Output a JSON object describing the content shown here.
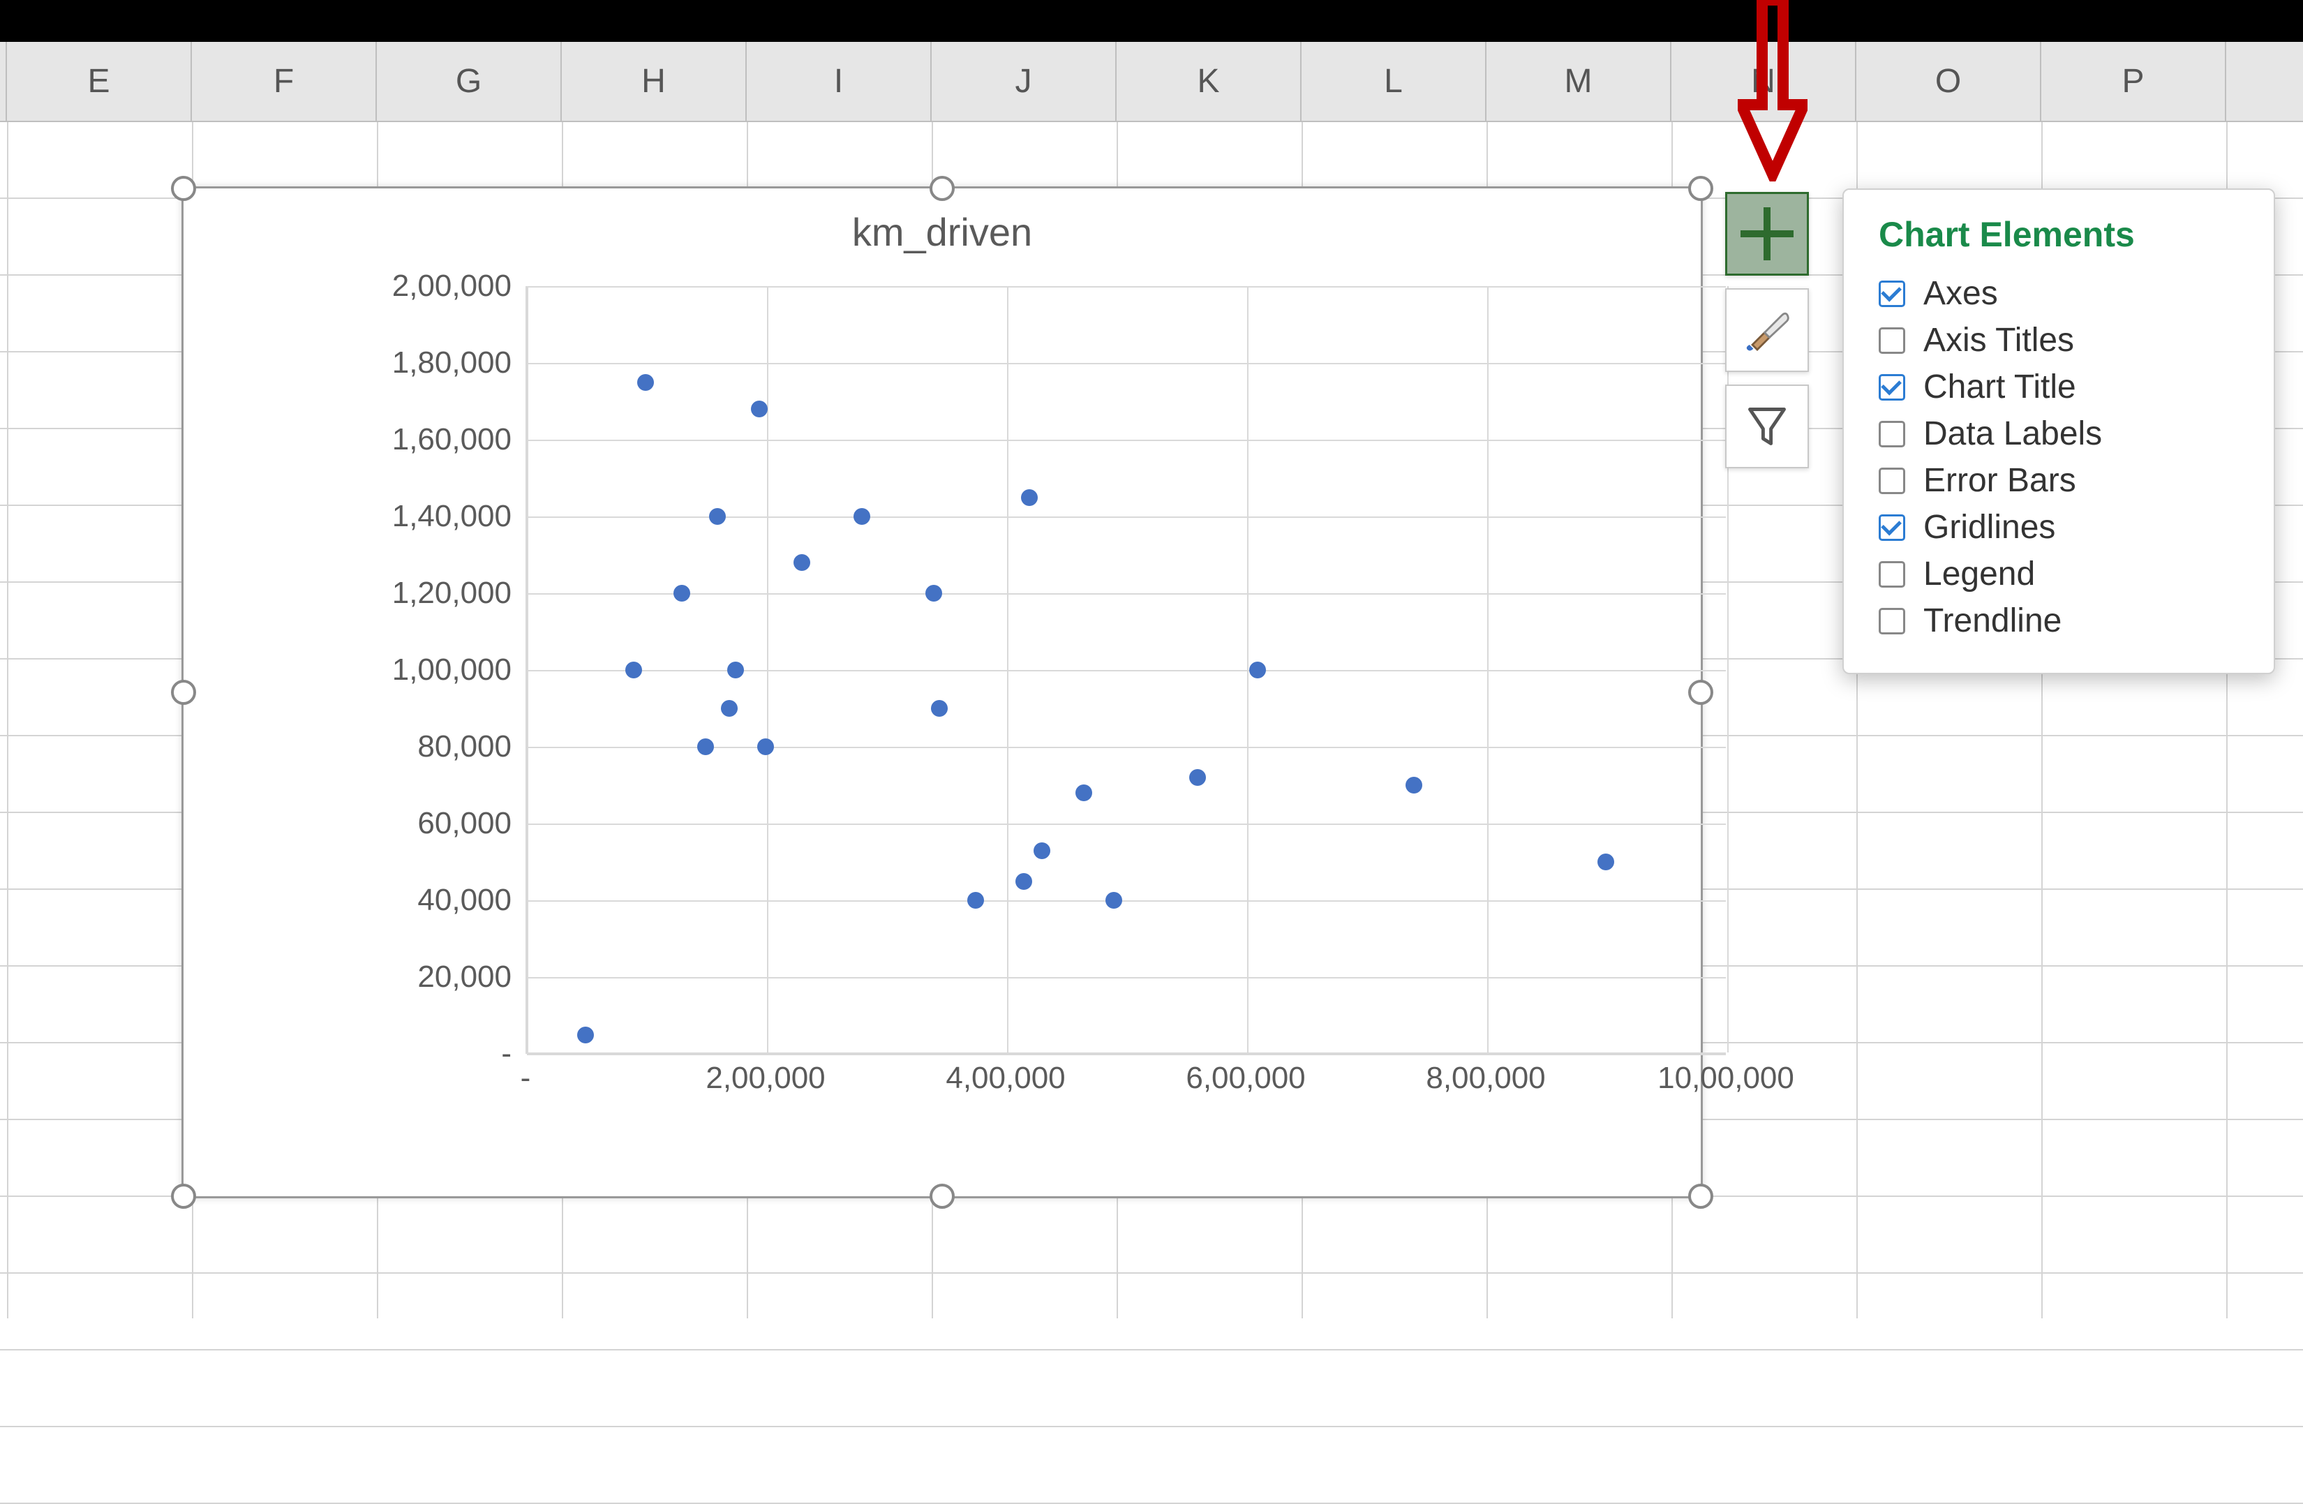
{
  "columns": [
    "E",
    "F",
    "G",
    "H",
    "I",
    "J",
    "K",
    "L",
    "M",
    "N",
    "O",
    "P"
  ],
  "chart_elements_panel": {
    "title": "Chart Elements",
    "items": [
      {
        "label": "Axes",
        "checked": true
      },
      {
        "label": "Axis Titles",
        "checked": false
      },
      {
        "label": "Chart Title",
        "checked": true
      },
      {
        "label": "Data Labels",
        "checked": false
      },
      {
        "label": "Error Bars",
        "checked": false
      },
      {
        "label": "Gridlines",
        "checked": true
      },
      {
        "label": "Legend",
        "checked": false
      },
      {
        "label": "Trendline",
        "checked": false
      }
    ]
  },
  "chart_data": {
    "type": "scatter",
    "title": "km_driven",
    "xlabel": "",
    "ylabel": "",
    "xticks_labels": [
      "-",
      "2,00,000",
      "4,00,000",
      "6,00,000",
      "8,00,000",
      "10,00,000"
    ],
    "yticks_labels": [
      "-",
      "20,000",
      "40,000",
      "60,000",
      "80,000",
      "1,00,000",
      "1,20,000",
      "1,40,000",
      "1,60,000",
      "1,80,000",
      "2,00,000"
    ],
    "xlim": [
      0,
      1000000
    ],
    "ylim": [
      0,
      200000
    ],
    "x_grid": [
      0,
      200000,
      400000,
      600000,
      800000,
      1000000
    ],
    "y_grid": [
      0,
      20000,
      40000,
      60000,
      80000,
      100000,
      120000,
      140000,
      160000,
      180000,
      200000
    ],
    "series": [
      {
        "name": "km_driven",
        "points": [
          {
            "x": 50000,
            "y": 5000
          },
          {
            "x": 90000,
            "y": 100000
          },
          {
            "x": 100000,
            "y": 175000
          },
          {
            "x": 130000,
            "y": 120000
          },
          {
            "x": 150000,
            "y": 80000
          },
          {
            "x": 160000,
            "y": 140000
          },
          {
            "x": 170000,
            "y": 90000
          },
          {
            "x": 175000,
            "y": 100000
          },
          {
            "x": 195000,
            "y": 168000
          },
          {
            "x": 200000,
            "y": 80000
          },
          {
            "x": 230000,
            "y": 128000
          },
          {
            "x": 280000,
            "y": 140000
          },
          {
            "x": 340000,
            "y": 120000
          },
          {
            "x": 345000,
            "y": 90000
          },
          {
            "x": 375000,
            "y": 40000
          },
          {
            "x": 415000,
            "y": 45000
          },
          {
            "x": 420000,
            "y": 145000
          },
          {
            "x": 430000,
            "y": 53000
          },
          {
            "x": 465000,
            "y": 68000
          },
          {
            "x": 490000,
            "y": 40000
          },
          {
            "x": 560000,
            "y": 72000
          },
          {
            "x": 610000,
            "y": 100000
          },
          {
            "x": 740000,
            "y": 70000
          },
          {
            "x": 900000,
            "y": 50000
          }
        ]
      }
    ]
  }
}
